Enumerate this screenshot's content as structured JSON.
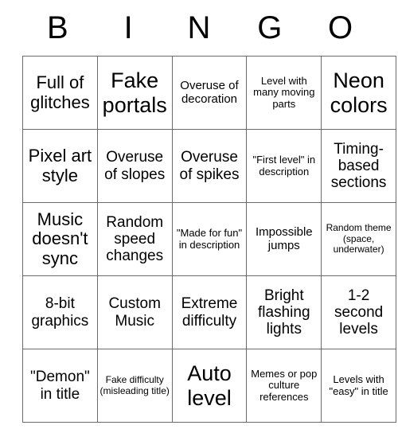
{
  "card": {
    "header": {
      "letters": [
        "B",
        "I",
        "N",
        "G",
        "O"
      ]
    },
    "columns": [
      "B",
      "I",
      "N",
      "G",
      "O"
    ],
    "rows": [
      {
        "cells": [
          {
            "text": "Full of glitches",
            "size": "lg"
          },
          {
            "text": "Fake portals",
            "size": "xl"
          },
          {
            "text": "Overuse of decoration",
            "size": "sm"
          },
          {
            "text": "Level with many moving parts",
            "size": "xs"
          },
          {
            "text": "Neon colors",
            "size": "xl"
          }
        ]
      },
      {
        "cells": [
          {
            "text": "Pixel art style",
            "size": "lg"
          },
          {
            "text": "Overuse of slopes",
            "size": "md"
          },
          {
            "text": "Overuse of spikes",
            "size": "md"
          },
          {
            "text": "\"First level\" in description",
            "size": "xs"
          },
          {
            "text": "Timing-based sections",
            "size": "md"
          }
        ]
      },
      {
        "cells": [
          {
            "text": "Music doesn't sync",
            "size": "lg"
          },
          {
            "text": "Random speed changes",
            "size": "md"
          },
          {
            "text": "\"Made for fun\" in description",
            "size": "xs"
          },
          {
            "text": "Impossible jumps",
            "size": "sm"
          },
          {
            "text": "Random theme (space, underwater)",
            "size": "xxs"
          }
        ]
      },
      {
        "cells": [
          {
            "text": "8-bit graphics",
            "size": "md"
          },
          {
            "text": "Custom Music",
            "size": "md"
          },
          {
            "text": "Extreme difficulty",
            "size": "md"
          },
          {
            "text": "Bright flashing lights",
            "size": "md"
          },
          {
            "text": "1-2 second levels",
            "size": "md"
          }
        ]
      },
      {
        "cells": [
          {
            "text": "\"Demon\" in title",
            "size": "md"
          },
          {
            "text": "Fake difficulty (misleading title)",
            "size": "xxs"
          },
          {
            "text": "Auto level",
            "size": "xl"
          },
          {
            "text": "Memes or pop culture references",
            "size": "xs"
          },
          {
            "text": "Levels with \"easy\" in title",
            "size": "xs"
          }
        ]
      }
    ]
  },
  "theme": {
    "background": "#ffffff",
    "text_color": "#000000",
    "grid_line_color": "#6b6b6b"
  }
}
